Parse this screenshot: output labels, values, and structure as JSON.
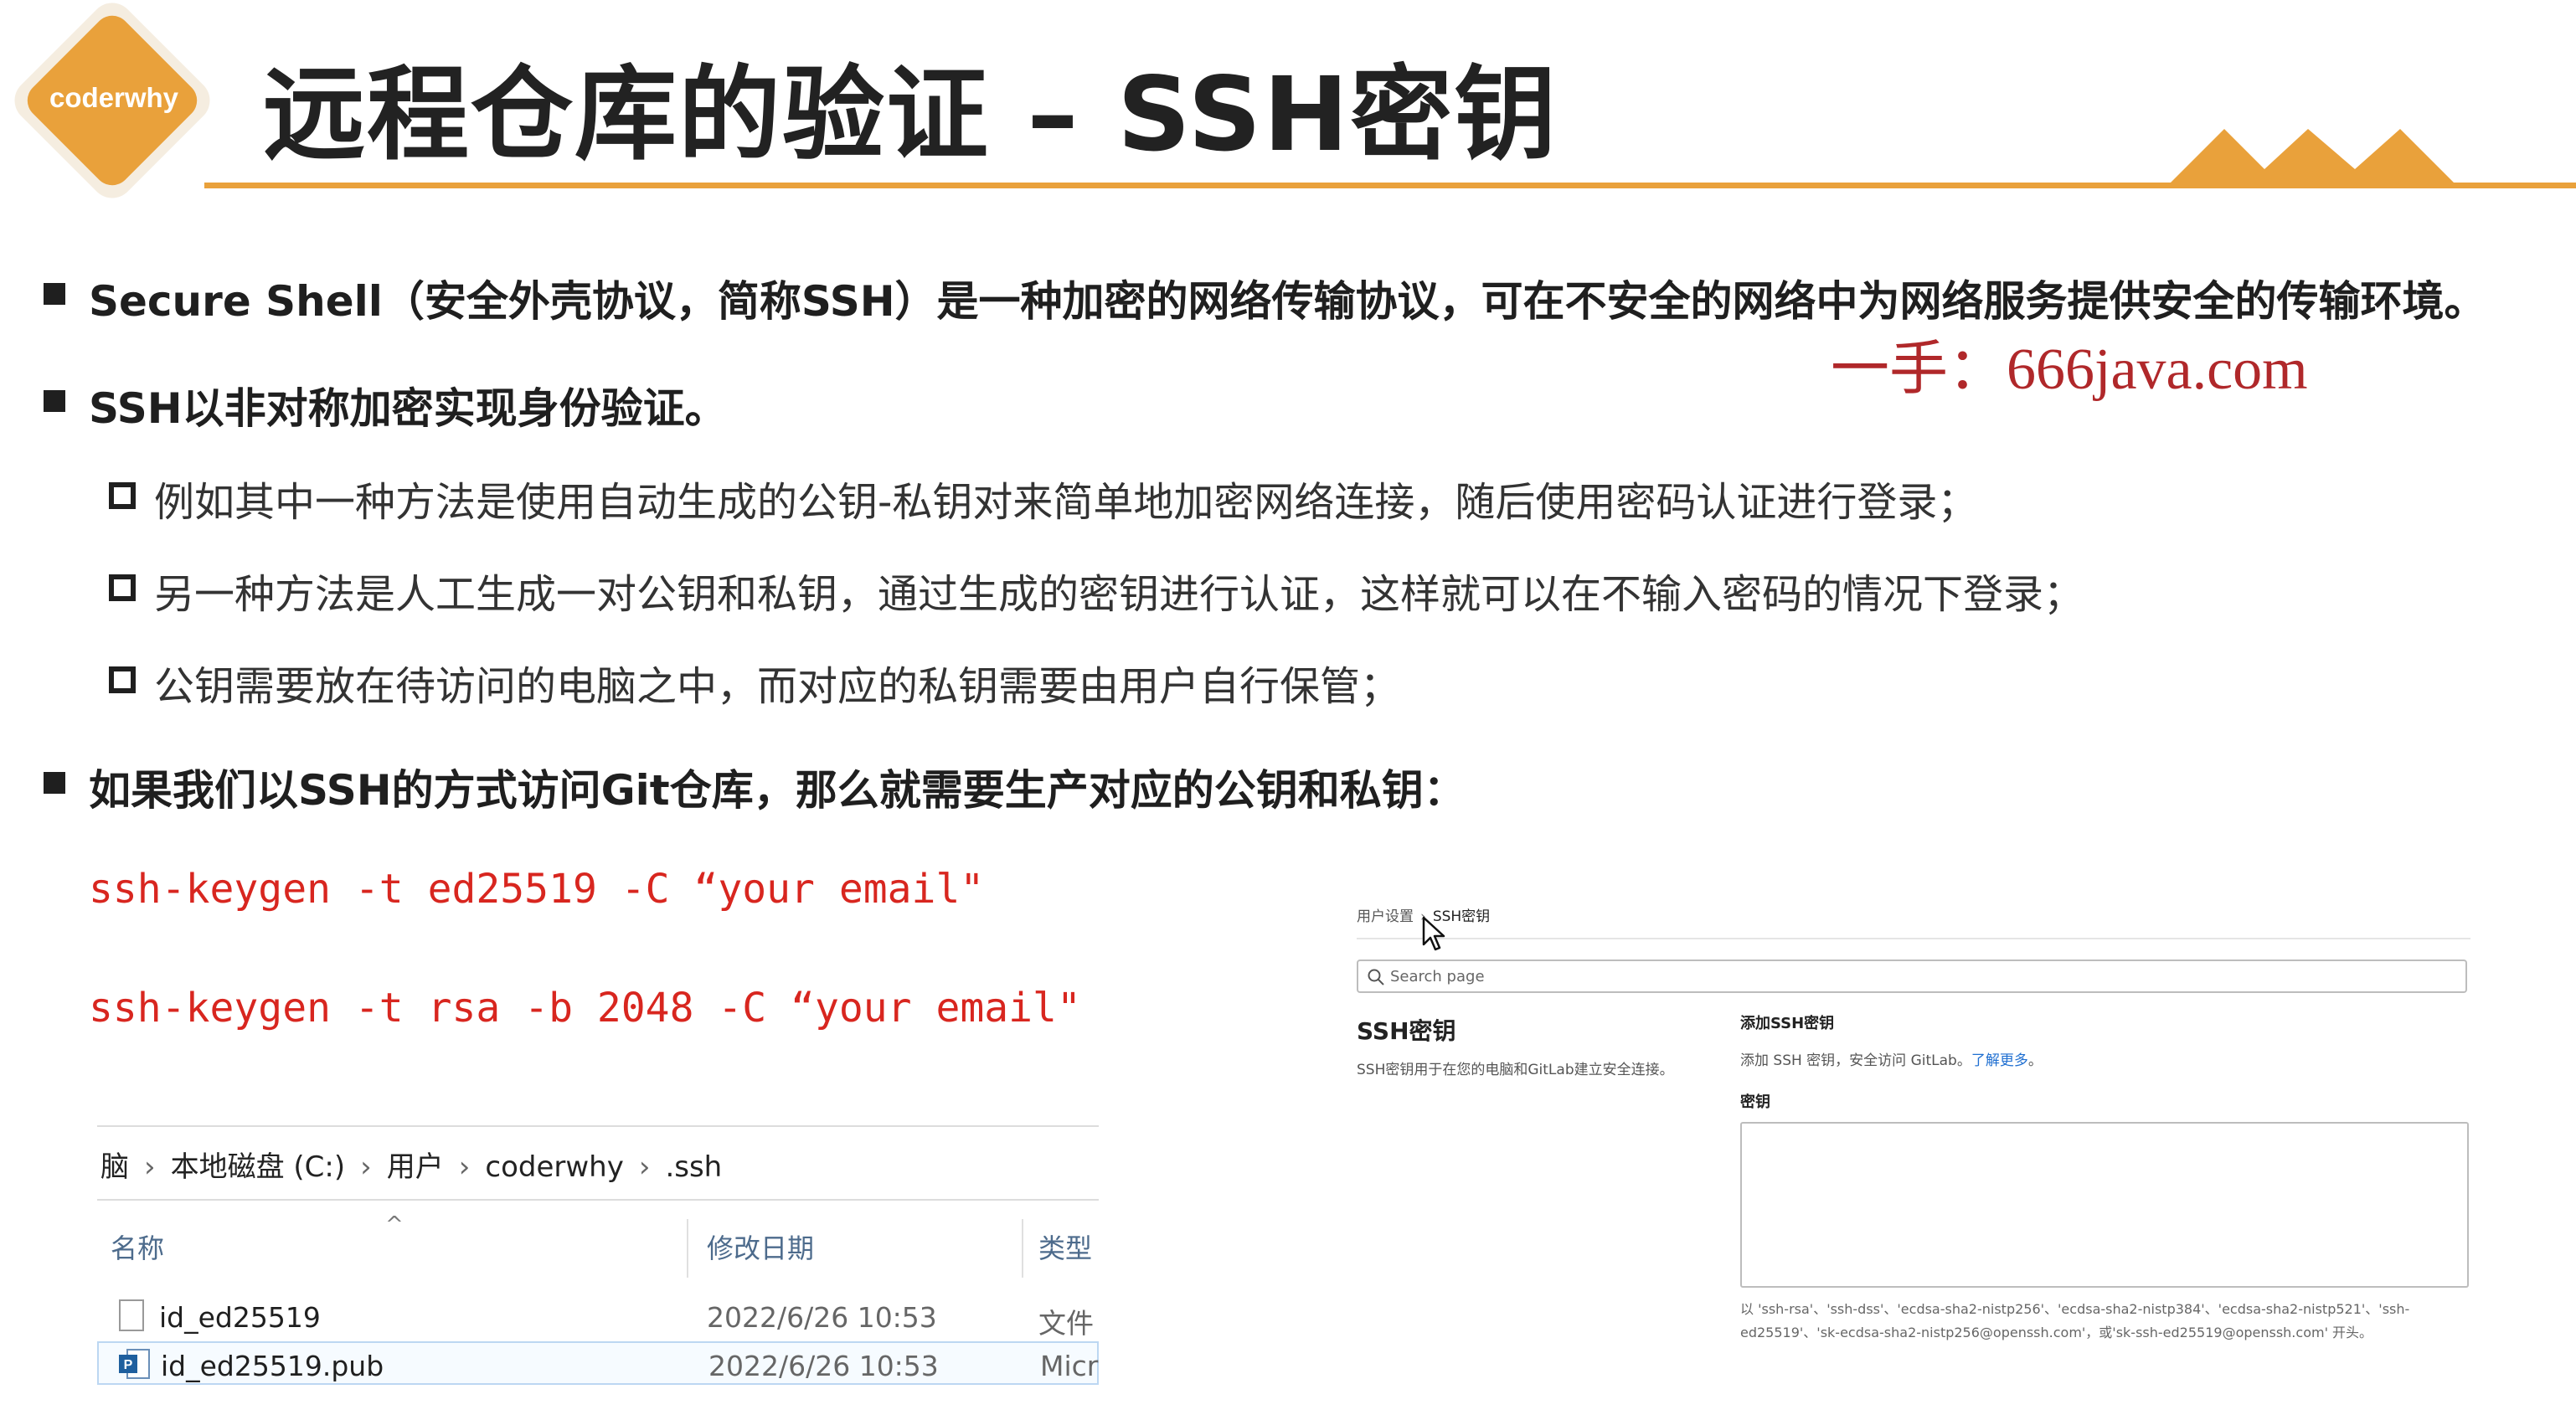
{
  "header": {
    "logo_text": "coderwhy",
    "title": "远程仓库的验证 – SSH密钥",
    "accent_color": "#e9a13b"
  },
  "watermark": "一手：666java.com",
  "bullets": {
    "b1": "Secure Shell（安全外壳协议，简称SSH）是一种加密的网络传输协议，可在不安全的网络中为网络服务提供安全的传输环境。",
    "b2": "SSH以非对称加密实现身份验证。",
    "b2_sub": [
      "例如其中一种方法是使用自动生成的公钥-私钥对来简单地加密网络连接，随后使用密码认证进行登录；",
      "另一种方法是人工生成一对公钥和私钥，通过生成的密钥进行认证，这样就可以在不输入密码的情况下登录；",
      "公钥需要放在待访问的电脑之中，而对应的私钥需要由用户自行保管；"
    ],
    "b3": "如果我们以SSH的方式访问Git仓库，那么就需要生产对应的公钥和私钥："
  },
  "commands": [
    "ssh-keygen -t ed25519 -C “your email\"",
    "ssh-keygen -t rsa -b 2048 -C “your email\""
  ],
  "explorer": {
    "breadcrumb": [
      "脑",
      "本地磁盘 (C:)",
      "用户",
      "coderwhy",
      ".ssh"
    ],
    "columns": {
      "name": "名称",
      "modified": "修改日期",
      "type": "类型"
    },
    "files": [
      {
        "name": "id_ed25519",
        "modified": "2022/6/26 10:53",
        "type": "文件",
        "icon": "file-icon"
      },
      {
        "name": "id_ed25519.pub",
        "modified": "2022/6/26 10:53",
        "type": "Micr",
        "icon": "publisher-file-icon"
      }
    ]
  },
  "gitlab": {
    "breadcrumb": [
      "用户设置",
      "SSH密钥"
    ],
    "search_placeholder": "Search page",
    "section_title": "SSH密钥",
    "section_desc": "SSH密钥用于在您的电脑和GitLab建立安全连接。",
    "add_title": "添加SSH密钥",
    "add_desc": "添加 SSH 密钥，安全访问 GitLab。",
    "learn_more": "了解更多",
    "key_label": "密钥",
    "key_value": "",
    "help_text": "以 'ssh-rsa'、'ssh-dss'、'ecdsa-sha2-nistp256'、'ecdsa-sha2-nistp384'、'ecdsa-sha2-nistp521'、'ssh-ed25519'、'sk-ecdsa-sha2-nistp256@openssh.com'，或'sk-ssh-ed25519@openssh.com' 开头。"
  }
}
